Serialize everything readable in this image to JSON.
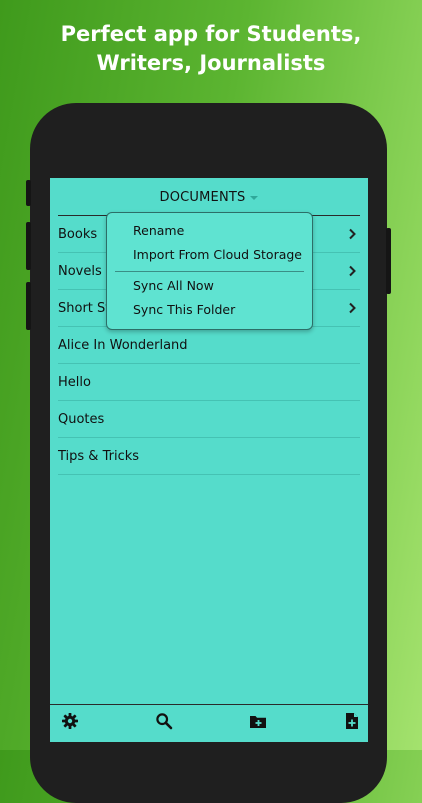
{
  "promo": {
    "line1": "Perfect app for Students,",
    "line2": "Writers, Journalists"
  },
  "nav": {
    "title": "DOCUMENTS"
  },
  "list": {
    "items": [
      {
        "label": "Books",
        "type": "folder"
      },
      {
        "label": "Novels",
        "type": "folder"
      },
      {
        "label": "Short St",
        "type": "folder"
      },
      {
        "label": "Alice In Wonderland",
        "type": "document"
      },
      {
        "label": "Hello",
        "type": "document"
      },
      {
        "label": "Quotes",
        "type": "document"
      },
      {
        "label": "Tips & Tricks",
        "type": "document"
      }
    ]
  },
  "menu": {
    "items": [
      {
        "label": "Rename"
      },
      {
        "label": "Import From Cloud Storage"
      },
      {
        "label": "Sync All Now"
      },
      {
        "label": "Sync This Folder"
      }
    ]
  },
  "toolbar": {
    "icons": [
      "gear-icon",
      "search-icon",
      "folder-add-icon",
      "document-add-icon"
    ]
  },
  "colors": {
    "screen_bg": "#55dccb",
    "menu_bg": "#5fe3d1",
    "background_green": "#5cb531"
  }
}
